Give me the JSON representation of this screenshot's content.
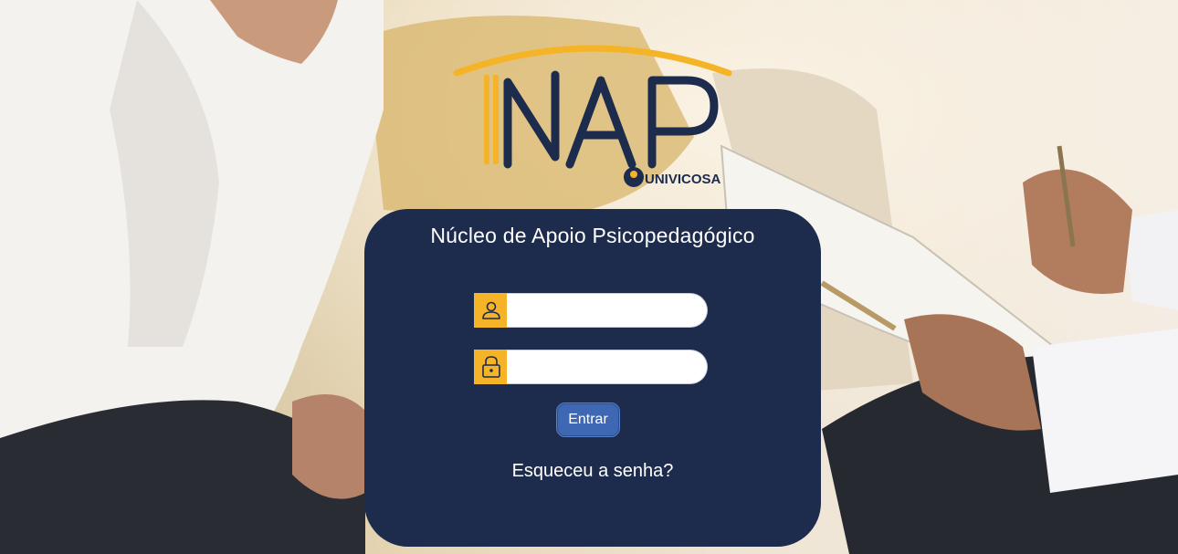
{
  "logo": {
    "text": "NAP",
    "subtext": "UNIVICOSA",
    "colors": {
      "navy": "#1d2b4d",
      "gold": "#f5b427"
    }
  },
  "login": {
    "title": "Núcleo de Apoio Psicopedagógico",
    "username_icon": "user-icon",
    "password_icon": "lock-icon",
    "username_value": "",
    "password_value": "",
    "submit_label": "Entrar",
    "forgot_label": "Esqueceu a senha?"
  },
  "colors": {
    "panel": "#1d2b4d",
    "accent": "#f5b427",
    "button": "#3e67b4"
  }
}
